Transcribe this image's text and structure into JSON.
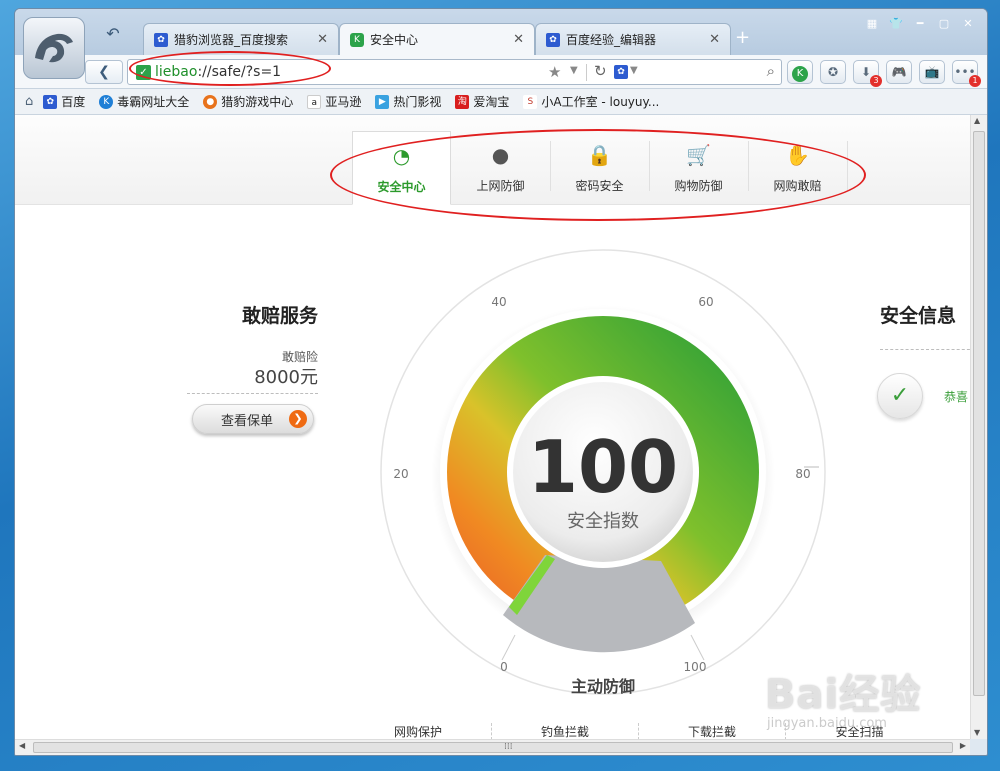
{
  "tabs": [
    {
      "label": "猎豹浏览器_百度搜索"
    },
    {
      "label": "安全中心"
    },
    {
      "label": "百度经验_编辑器"
    }
  ],
  "address": {
    "scheme": "liebao",
    "rest": "://safe/?s=1"
  },
  "toolbar": {
    "download_badge": "3",
    "menu_badge": "1"
  },
  "bookmarks": [
    {
      "label": "百度",
      "color": "#2d5bd0"
    },
    {
      "label": "毒霸网址大全",
      "color": "#1f7fd6"
    },
    {
      "label": "猎豹游戏中心",
      "color": "#e8731c"
    },
    {
      "label": "亚马逊",
      "color": "#222222"
    },
    {
      "label": "热门影视",
      "color": "#3aa2e0"
    },
    {
      "label": "爱淘宝",
      "color": "#d81e1e"
    },
    {
      "label": "小A工作室 - louyuy...",
      "color": "#c0392b"
    }
  ],
  "nav": [
    {
      "label": "安全中心",
      "icon": "gauge-icon",
      "glyph": "◔"
    },
    {
      "label": "上网防御",
      "icon": "ball-icon",
      "glyph": "●"
    },
    {
      "label": "密码安全",
      "icon": "lock-icon",
      "glyph": "🔒"
    },
    {
      "label": "购物防御",
      "icon": "cart-icon",
      "glyph": "🛒"
    },
    {
      "label": "网购敢赔",
      "icon": "hand-money-icon",
      "glyph": "✋"
    }
  ],
  "compensation": {
    "title": "敢赔服务",
    "label": "敢赔险",
    "amount": "8000元",
    "button": "查看保单"
  },
  "gauge": {
    "score": "100",
    "caption": "安全指数",
    "subtitle": "主动防御",
    "ticks": [
      "0",
      "20",
      "40",
      "60",
      "80",
      "100"
    ]
  },
  "info": {
    "title": "安全信息",
    "message": "恭喜"
  },
  "bottom_links": [
    "网购保护",
    "钓鱼拦截",
    "下载拦截",
    "安全扫描"
  ],
  "watermark": {
    "brand": "Bai经验",
    "url": "jingyan.baidu.com"
  }
}
